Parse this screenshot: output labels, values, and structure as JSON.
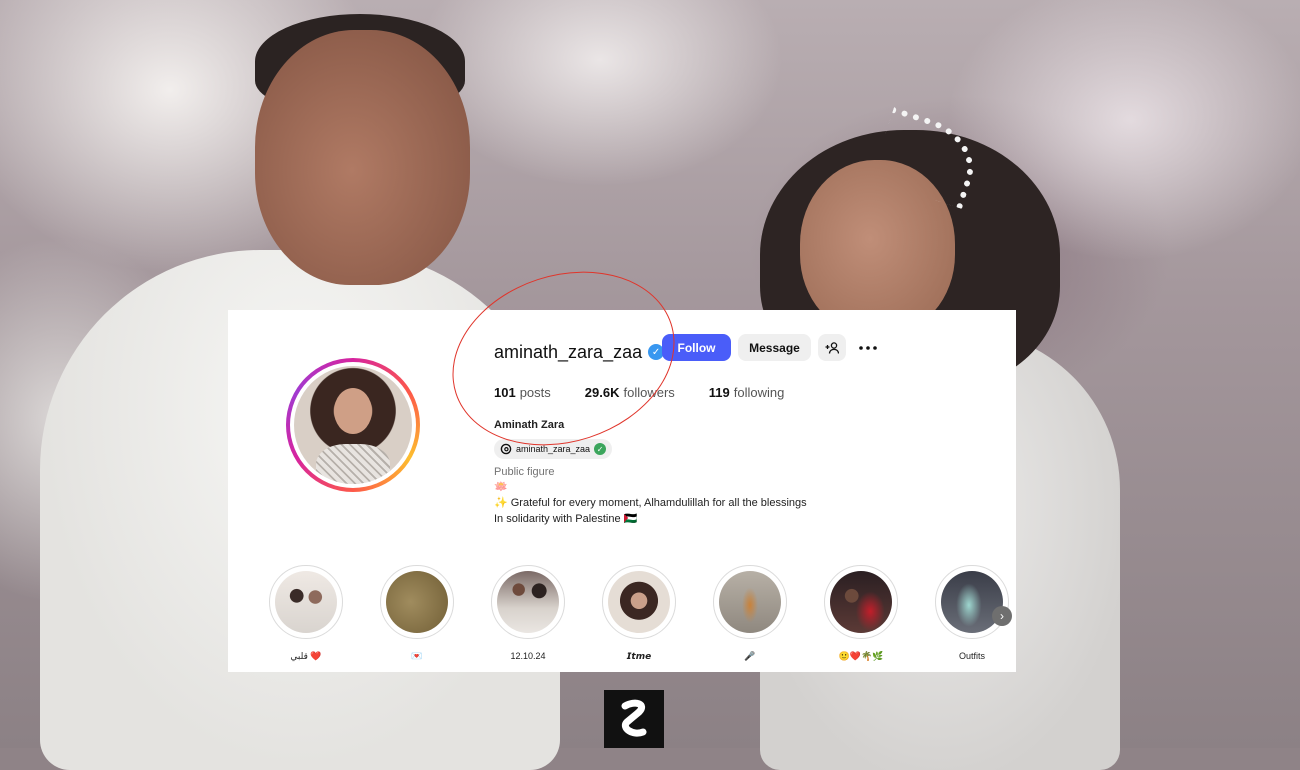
{
  "profile": {
    "username": "aminath_zara_zaa",
    "full_name": "Aminath Zara",
    "category": "Public figure",
    "threads_handle": "aminath_zara_zaa",
    "bio_lines": [
      "🪷",
      "✨ Grateful for every moment, Alhamdulillah for all the blessings",
      "In solidarity with Palestine 🇵🇸"
    ]
  },
  "actions": {
    "follow": "Follow",
    "message": "Message"
  },
  "stats": {
    "posts_count": "101",
    "posts_label": "posts",
    "followers_count": "29.6K",
    "followers_label": "followers",
    "following_count": "119",
    "following_label": "following"
  },
  "highlights": [
    {
      "label": "قلبي ❤️"
    },
    {
      "label": "💌"
    },
    {
      "label": "12.10.24"
    },
    {
      "label": "𝙄𝙩𝙢𝙚"
    },
    {
      "label": "🎤"
    },
    {
      "label": "🙂❤️🌴🌿"
    },
    {
      "label": "Outfits"
    }
  ],
  "icons": [
    "verified-badge-icon",
    "add-person-icon",
    "more-options-icon",
    "threads-icon",
    "chevron-right-icon"
  ],
  "colors": {
    "follow_button": "#4a5df9",
    "verified": "#3897f0",
    "annotation": "#e0352b"
  }
}
